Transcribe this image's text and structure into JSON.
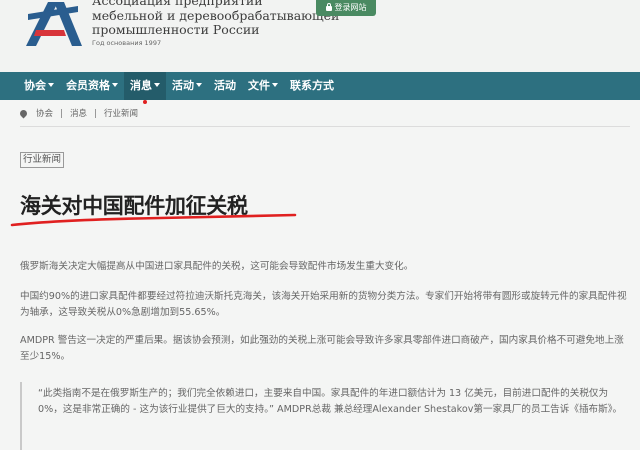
{
  "header": {
    "org_lines": [
      "Ассоциация предприятий",
      "мебельной и деревообрабатывающей",
      "промышленности России"
    ],
    "founded": "Год основания 1997",
    "login_label": "登录网站"
  },
  "colors": {
    "nav_bg": "#2d7080",
    "login_bg": "#4a8a62",
    "highlight_red": "#e02020",
    "logo_blue": "#2a5d8f",
    "logo_red": "#d8343a"
  },
  "nav": {
    "items": [
      {
        "label": "协会",
        "has_caret": true
      },
      {
        "label": "会员资格",
        "has_caret": true
      },
      {
        "label": "消息",
        "has_caret": true,
        "active": true
      },
      {
        "label": "活动",
        "has_caret": true
      },
      {
        "label": "活动",
        "has_caret": false
      },
      {
        "label": "文件",
        "has_caret": true
      },
      {
        "label": "联系方式",
        "has_caret": false
      }
    ]
  },
  "breadcrumb": {
    "icon": "location-pin-icon",
    "items": [
      "协会",
      "消息",
      "行业新闻"
    ]
  },
  "article": {
    "tag": "行业新闻",
    "title": "海关对中国配件加征关税",
    "paragraphs": [
      "俄罗斯海关决定大幅提高从中国进口家具配件的关税，这可能会导致配件市场发生重大变化。",
      "中国约90%的进口家具配件都要经过符拉迪沃斯托克海关，该海关开始采用新的货物分类方法。专家们开始将带有圆形或旋转元件的家具配件视为轴承，这导致关税从0%急剧增加到55.65%。",
      "AMDPR 警告这一决定的严重后果。据该协会预测，如此强劲的关税上涨可能会导致许多家具零部件进口商破产，国内家具价格不可避免地上涨至少15%。"
    ],
    "quote": "“此类指南不是在俄罗斯生产的；我们完全依赖进口，主要来自中国。家具配件的年进口额估计为 13 亿美元，目前进口配件的关税仅为 0%，这是非常正确的 - 这为该行业提供了巨大的支持。” AMDPR总裁 兼总经理Alexander Shestakov第一家具厂的员工告诉《插布斯》。"
  }
}
